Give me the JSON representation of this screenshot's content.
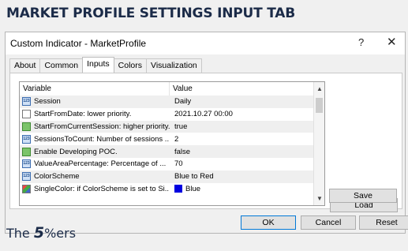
{
  "headline": "MARKET PROFILE SETTINGS INPUT TAB",
  "window": {
    "title": "Custom Indicator - MarketProfile",
    "help_label": "?",
    "close_label": "✕"
  },
  "tabs": [
    {
      "label": "About"
    },
    {
      "label": "Common"
    },
    {
      "label": "Inputs",
      "active": true
    },
    {
      "label": "Colors"
    },
    {
      "label": "Visualization"
    }
  ],
  "grid": {
    "headers": {
      "variable": "Variable",
      "value": "Value"
    },
    "rows": [
      {
        "icon": "number-icon",
        "variable": "Session",
        "value": "Daily"
      },
      {
        "icon": "calendar-icon",
        "variable": "StartFromDate: lower priority.",
        "value": "2021.10.27 00:00"
      },
      {
        "icon": "boolean-icon",
        "variable": "StartFromCurrentSession: higher priority.",
        "value": "true"
      },
      {
        "icon": "number-icon",
        "variable": "SessionsToCount: Number of sessions ...",
        "value": "2"
      },
      {
        "icon": "boolean-icon",
        "variable": "Enable Developing POC.",
        "value": "false"
      },
      {
        "icon": "number-icon",
        "variable": "ValueAreaPercentage: Percentage of ...",
        "value": "70"
      },
      {
        "icon": "number-icon",
        "variable": "ColorScheme",
        "value": "Blue to Red"
      },
      {
        "icon": "color-icon",
        "variable": "SingleColor: if ColorScheme is set to Si...",
        "value": "Blue",
        "swatch": "#0000e0"
      }
    ]
  },
  "buttons": {
    "load": "Load",
    "save": "Save",
    "ok": "OK",
    "cancel": "Cancel",
    "reset": "Reset"
  },
  "logo": {
    "the": "The ",
    "five": "5",
    "ers": "%ers"
  }
}
